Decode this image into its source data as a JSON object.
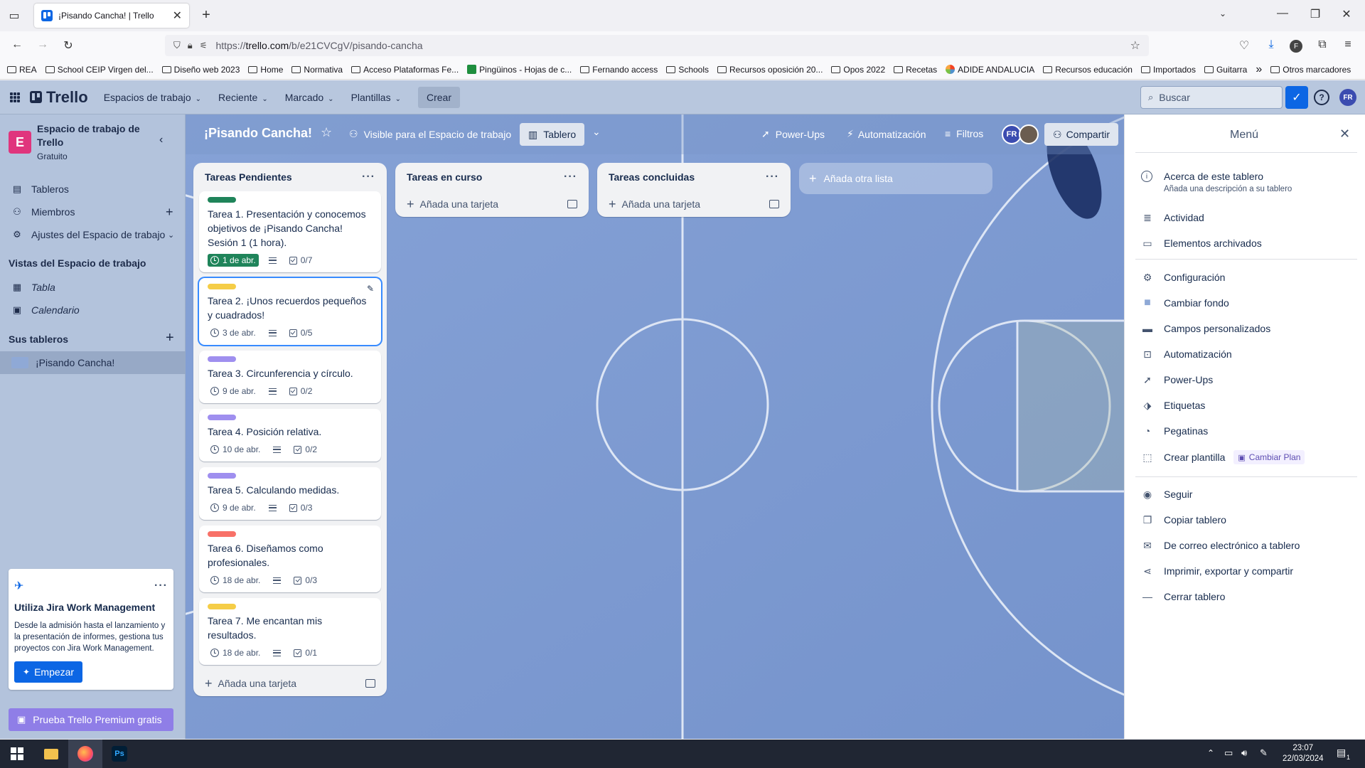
{
  "browser": {
    "tab_title": "¡Pisando Cancha! | Trello",
    "url_prefix": "https://",
    "url_domain": "trello.com",
    "url_path": "/b/e21CVCgV/pisando-cancha",
    "bookmarks": [
      "REA",
      "School CEIP Virgen del...",
      "Diseño web 2023",
      "Home",
      "Normativa",
      "Acceso Plataformas Fe...",
      "Pingüinos - Hojas de c...",
      "Fernando access",
      "Schools",
      "Recursos oposición 20...",
      "Opos 2022",
      "Recetas",
      "ADIDE ANDALUCIA",
      "Recursos educación",
      "Importados",
      "Guitarra"
    ],
    "bookmarks_more": "»",
    "other_bookmarks": "Otros marcadores"
  },
  "header": {
    "logo": "Trello",
    "menus": [
      "Espacios de trabajo",
      "Reciente",
      "Marcado",
      "Plantillas"
    ],
    "create": "Crear",
    "search_placeholder": "Buscar",
    "user_initials": "FR"
  },
  "sidebar": {
    "workspace_initial": "E",
    "workspace_name": "Espacio de trabajo de Trello",
    "workspace_plan": "Gratuito",
    "items": [
      {
        "icon": "board-icon",
        "label": "Tableros"
      },
      {
        "icon": "person-icon",
        "label": "Miembros"
      },
      {
        "icon": "gear-icon",
        "label": "Ajustes del Espacio de trabajo"
      }
    ],
    "views_title": "Vistas del Espacio de trabajo",
    "views": [
      {
        "icon": "table-icon",
        "label": "Tabla"
      },
      {
        "icon": "calendar-icon",
        "label": "Calendario"
      }
    ],
    "boards_title": "Sus tableros",
    "boards": [
      "¡Pisando Cancha!"
    ],
    "promo": {
      "title": "Utiliza Jira Work Management",
      "text": "Desde la admisión hasta el lanzamiento y la presentación de informes, gestiona tus proyectos con Jira Work Management.",
      "button": "Empezar"
    },
    "premium": "Prueba Trello Premium gratis"
  },
  "board": {
    "title": "¡Pisando Cancha!",
    "visibility": "Visible para el Espacio de trabajo",
    "view": "Tablero",
    "powerups": "Power-Ups",
    "automation": "Automatización",
    "filters": "Filtros",
    "share": "Compartir",
    "member_initials": "FR",
    "lists": [
      {
        "title": "Tareas Pendientes",
        "add": "Añada una tarjeta",
        "cards": [
          {
            "label_color": "#1f845a",
            "title": "Tarea 1. Presentación y conocemos objetivos de ¡Pisando Cancha! Sesión 1 (1 hora).",
            "due": "1 de abr.",
            "due_style": "green",
            "checklist": "0/7"
          },
          {
            "label_color": "#f5cd47",
            "title": "Tarea 2. ¡Unos recuerdos pequeños y cuadrados!",
            "due": "3 de abr.",
            "due_style": "",
            "checklist": "0/5"
          },
          {
            "label_color": "#9f8fef",
            "title": "Tarea 3. Circunferencia y círculo.",
            "due": "9 de abr.",
            "due_style": "",
            "checklist": "0/2"
          },
          {
            "label_color": "#9f8fef",
            "title": "Tarea 4. Posición relativa.",
            "due": "10 de abr.",
            "due_style": "",
            "checklist": "0/2"
          },
          {
            "label_color": "#9f8fef",
            "title": "Tarea 5. Calculando medidas.",
            "due": "9 de abr.",
            "due_style": "",
            "checklist": "0/3"
          },
          {
            "label_color": "#f87168",
            "title": "Tarea 6. Diseñamos como profesionales.",
            "due": "18 de abr.",
            "due_style": "",
            "checklist": "0/3"
          },
          {
            "label_color": "#f5cd47",
            "title": "Tarea 7. Me encantan mis resultados.",
            "due": "18 de abr.",
            "due_style": "",
            "checklist": "0/1"
          }
        ]
      },
      {
        "title": "Tareas en curso",
        "add": "Añada una tarjeta",
        "cards": []
      },
      {
        "title": "Tareas concluidas",
        "add": "Añada una tarjeta",
        "cards": []
      }
    ],
    "add_list": "Añada otra lista"
  },
  "menu": {
    "title": "Menú",
    "about_title": "Acerca de este tablero",
    "about_sub": "Añada una descripción a su tablero",
    "group1": [
      {
        "icon": "activity-icon",
        "label": "Actividad"
      },
      {
        "icon": "archive-icon",
        "label": "Elementos archivados"
      }
    ],
    "group2": [
      {
        "icon": "gear-icon",
        "label": "Configuración"
      },
      {
        "icon": "background-icon",
        "label": "Cambiar fondo"
      },
      {
        "icon": "custom-fields-icon",
        "label": "Campos personalizados"
      },
      {
        "icon": "automation-icon",
        "label": "Automatización"
      },
      {
        "icon": "rocket-icon",
        "label": "Power-Ups"
      },
      {
        "icon": "tag-icon",
        "label": "Etiquetas"
      },
      {
        "icon": "sticker-icon",
        "label": "Pegatinas"
      }
    ],
    "template": "Crear plantilla",
    "upgrade": "Cambiar Plan",
    "group3": [
      {
        "icon": "eye-icon",
        "label": "Seguir"
      },
      {
        "icon": "copy-icon",
        "label": "Copiar tablero"
      },
      {
        "icon": "email-icon",
        "label": "De correo electrónico a tablero"
      },
      {
        "icon": "share-icon",
        "label": "Imprimir, exportar y compartir"
      },
      {
        "icon": "minus-icon",
        "label": "Cerrar tablero"
      }
    ]
  },
  "taskbar": {
    "time": "23:07",
    "date": "22/03/2024",
    "notifications": "1"
  }
}
